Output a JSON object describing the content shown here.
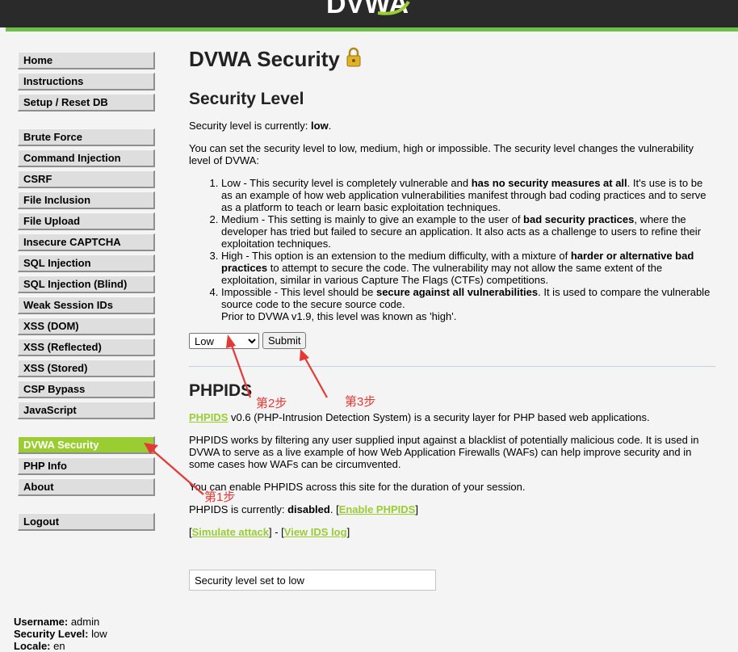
{
  "header": {
    "logo_text": "DVWA"
  },
  "sidebar": {
    "group1": [
      "Home",
      "Instructions",
      "Setup / Reset DB"
    ],
    "group2": [
      "Brute Force",
      "Command Injection",
      "CSRF",
      "File Inclusion",
      "File Upload",
      "Insecure CAPTCHA",
      "SQL Injection",
      "SQL Injection (Blind)",
      "Weak Session IDs",
      "XSS (DOM)",
      "XSS (Reflected)",
      "XSS (Stored)",
      "CSP Bypass",
      "JavaScript"
    ],
    "group3": [
      "DVWA Security",
      "PHP Info",
      "About"
    ],
    "group4": [
      "Logout"
    ],
    "selected": "DVWA Security",
    "selected_color": "#9acd32"
  },
  "footer": {
    "username_label": "Username:",
    "username": "admin",
    "level_label": "Security Level:",
    "level": "low",
    "locale_label": "Locale:",
    "locale": "en"
  },
  "main": {
    "title": "DVWA Security",
    "lock_icon": "lock-icon",
    "section_title": "Security Level",
    "current_prefix": "Security level is currently:",
    "current_value": "low",
    "current_suffix": ".",
    "intro": "You can set the security level to low, medium, high or impossible. The security level changes the vulnerability level of DVWA:",
    "levels": [
      {
        "a": "Low - This security level is completely vulnerable and ",
        "b": "has no security measures at all",
        "c": ". It's use is to be as an example of how web application vulnerabilities manifest through bad coding practices and to serve as a platform to teach or learn basic exploitation techniques."
      },
      {
        "a": "Medium - This setting is mainly to give an example to the user of ",
        "b": "bad security practices",
        "c": ", where the developer has tried but failed to secure an application. It also acts as a challenge to users to refine their exploitation techniques."
      },
      {
        "a": "High - This option is an extension to the medium difficulty, with a mixture of ",
        "b": "harder or alternative bad practices",
        "c": " to attempt to secure the code. The vulnerability may not allow the same extent of the exploitation, similar in various Capture The Flags (CTFs) competitions."
      },
      {
        "a": "Impossible - This level should be ",
        "b": "secure against all vulnerabilities",
        "c": ". It is used to compare the vulnerable source code to the secure source code.",
        "d": "Prior to DVWA v1.9, this level was known as 'high'."
      }
    ],
    "select_value": "Low",
    "submit_label": "Submit",
    "phpids_title": "PHPIDS",
    "phpids_link": "PHPIDS",
    "phpids_desc": " v0.6 (PHP-Intrusion Detection System) is a security layer for PHP based web applications.",
    "phpids_p2": "PHPIDS works by filtering any user supplied input against a blacklist of potentially malicious code. It is used in DVWA to serve as a live example of how Web Application Firewalls (WAFs) can help improve security and in some cases how WAFs can be circumvented.",
    "phpids_p3": "You can enable PHPIDS across this site for the duration of your session.",
    "phpids_status_prefix": "PHPIDS is currently: ",
    "phpids_status": "disabled",
    "phpids_status_suffix": ". [",
    "enable_link": "Enable PHPIDS",
    "bracket_close": "]",
    "simulate_open": "[",
    "simulate_link": "Simulate attack",
    "sep": "] - [",
    "view_log_link": "View IDS log",
    "end_bracket": "]",
    "message": "Security level set to low"
  },
  "annotations": {
    "step1": "第1步",
    "step2": "第2步",
    "step3": "第3步",
    "color": "#e53935"
  }
}
